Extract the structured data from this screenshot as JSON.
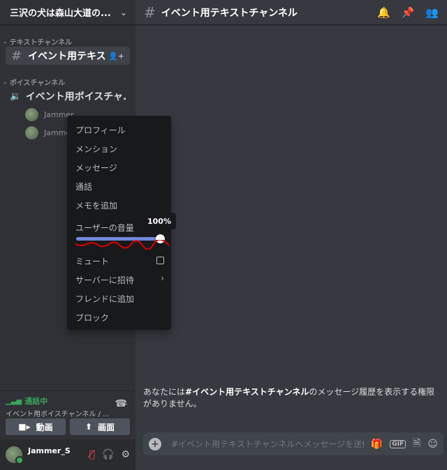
{
  "server": {
    "name": "三沢の犬は森山大道の...",
    "chevron_icon": "chevron-down-icon"
  },
  "sidebar": {
    "text_category": "テキストチャンネル",
    "voice_category": "ボイスチャンネル",
    "text_channel": "イベント用テキスト...",
    "voice_channel": "イベント用ボイスチャ...",
    "voice_users": [
      "Jammer",
      "Jammer"
    ]
  },
  "voice_panel": {
    "status": "通話中",
    "channel": "イベント用ボイスチャンネル / ...",
    "video_label": "動画",
    "screen_label": "画面"
  },
  "user_panel": {
    "username": "Jammer_S"
  },
  "header": {
    "channel_title": "イベント用テキストチャンネル"
  },
  "message": {
    "prefix": "あなたには",
    "channel": "#イベント用テキストチャンネル",
    "suffix": "のメッセージ履歴を表示する権限がありません。"
  },
  "composer": {
    "placeholder": "#イベント用テキストチャンネルへメッセージを送信",
    "gif_label": "GIF"
  },
  "context_menu": {
    "profile": "プロフィール",
    "mention": "メンション",
    "message": "メッセージ",
    "call": "通話",
    "add_note": "メモを追加",
    "user_volume": "ユーザーの音量",
    "volume_percent": 100,
    "volume_tooltip": "100%",
    "mute": "ミュート",
    "invite": "サーバーに招待",
    "add_friend": "フレンドに追加",
    "block": "ブロック"
  },
  "colors": {
    "accent": "#7289da",
    "online": "#3ba55c",
    "danger": "#ed4245",
    "annotation": "#cc0000"
  }
}
